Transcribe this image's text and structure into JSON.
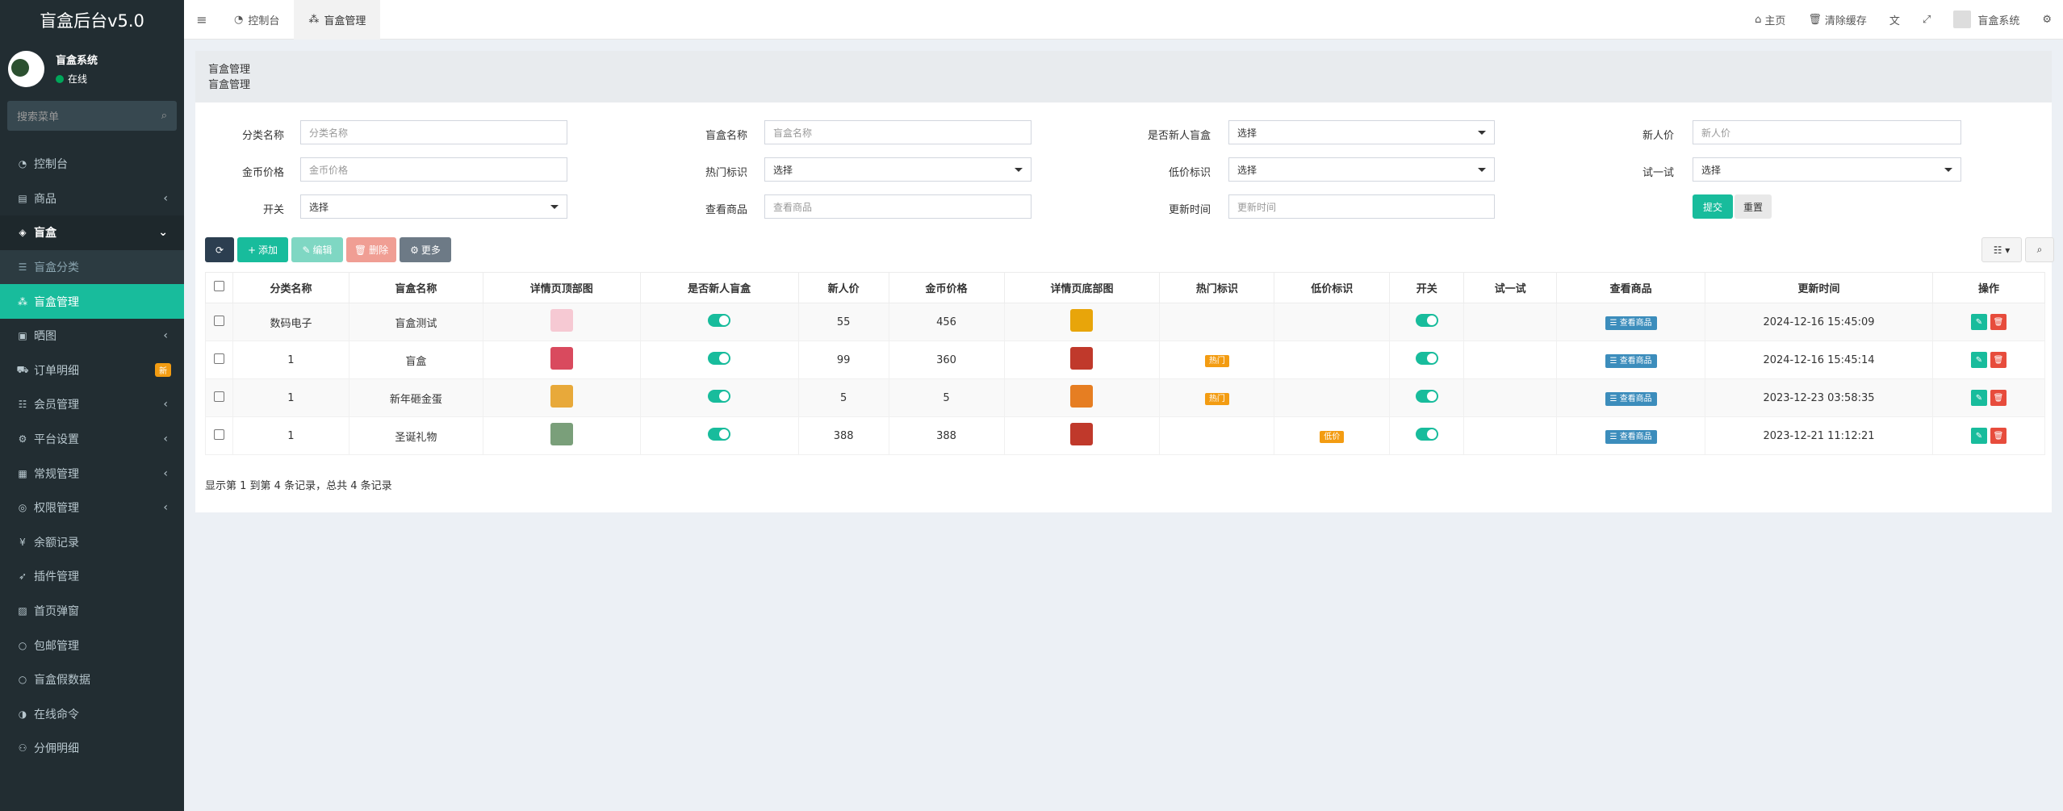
{
  "sidebar": {
    "brand": "盲盒后台v5.0",
    "user_name": "盲盒系统",
    "user_status": "在线",
    "search_placeholder": "搜索菜单",
    "items": [
      {
        "label": "控制台",
        "icon": "dashboard-icon"
      },
      {
        "label": "商品",
        "icon": "shopping-bag-icon"
      },
      {
        "label": "盲盒",
        "icon": "cube-icon"
      },
      {
        "label": "盲盒分类",
        "icon": "list-icon"
      },
      {
        "label": "盲盒管理",
        "icon": "cubes-icon"
      },
      {
        "label": "晒图",
        "icon": "gift-icon"
      },
      {
        "label": "订单明细",
        "icon": "cart-icon",
        "badge": "新"
      },
      {
        "label": "会员管理",
        "icon": "user-list-icon"
      },
      {
        "label": "平台设置",
        "icon": "gear-icon"
      },
      {
        "label": "常规管理",
        "icon": "cogs-icon"
      },
      {
        "label": "权限管理",
        "icon": "group-icon"
      },
      {
        "label": "余额记录",
        "icon": "yen-icon"
      },
      {
        "label": "插件管理",
        "icon": "rocket-icon"
      },
      {
        "label": "首页弹窗",
        "icon": "image-icon"
      },
      {
        "label": "包邮管理",
        "icon": "circle-icon"
      },
      {
        "label": "盲盒假数据",
        "icon": "circle-icon"
      },
      {
        "label": "在线命令",
        "icon": "adjust-icon"
      },
      {
        "label": "分佣明细",
        "icon": "users-icon"
      }
    ]
  },
  "topbar": {
    "tabs": [
      "控制台",
      "盲盒管理"
    ],
    "home": "主页",
    "clear_cache": "清除缓存",
    "user": "盲盒系统"
  },
  "panel": {
    "title": "盲盒管理",
    "subtitle": "盲盒管理"
  },
  "form": {
    "labels": [
      "分类名称",
      "盲盒名称",
      "是否新人盲盒",
      "新人价",
      "金币价格",
      "热门标识",
      "低价标识",
      "试一试",
      "开关",
      "查看商品",
      "更新时间"
    ],
    "placeholders": {
      "category": "分类名称",
      "name": "盲盒名称",
      "new_price": "新人价",
      "coin_price": "金币价格",
      "view_goods": "查看商品",
      "update_time": "更新时间"
    },
    "select_default": "选择",
    "submit": "提交",
    "reset": "重置"
  },
  "toolbar": {
    "add": "添加",
    "edit": "编辑",
    "delete": "删除",
    "more": "更多"
  },
  "table": {
    "headers": [
      "分类名称",
      "盲盒名称",
      "详情页顶部图",
      "是否新人盲盒",
      "新人价",
      "金币价格",
      "详情页底部图",
      "热门标识",
      "低价标识",
      "开关",
      "试一试",
      "查看商品",
      "更新时间",
      "操作"
    ],
    "view_btn": "查看商品",
    "rows": [
      {
        "category": "数码电子",
        "name": "盲盒测试",
        "new_price": "55",
        "coin_price": "456",
        "hot": "",
        "low": "",
        "time": "2024-12-16 15:45:09",
        "top_color": "#f6c9d3",
        "bottom_color": "#e8a50a"
      },
      {
        "category": "1",
        "name": "盲盒",
        "new_price": "99",
        "coin_price": "360",
        "hot": "热门",
        "low": "",
        "time": "2024-12-16 15:45:14",
        "top_color": "#d94a5e",
        "bottom_color": "#c0392b"
      },
      {
        "category": "1",
        "name": "新年砸金蛋",
        "new_price": "5",
        "coin_price": "5",
        "hot": "热门",
        "low": "",
        "time": "2023-12-23 03:58:35",
        "top_color": "#e8a93a",
        "bottom_color": "#e67e22"
      },
      {
        "category": "1",
        "name": "圣诞礼物",
        "new_price": "388",
        "coin_price": "388",
        "hot": "",
        "low": "低价",
        "time": "2023-12-21 11:12:21",
        "top_color": "#7a9f7a",
        "bottom_color": "#c0392b"
      }
    ]
  },
  "footer": "显示第 1 到第 4 条记录，总共 4 条记录"
}
